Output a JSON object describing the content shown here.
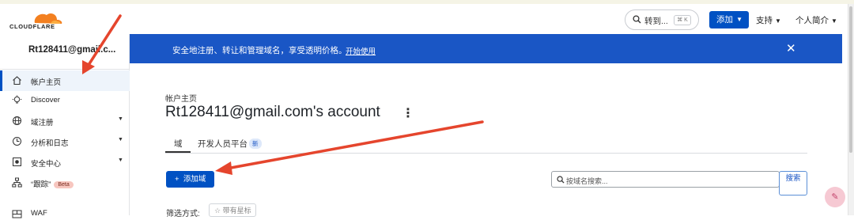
{
  "header": {
    "logo_text": "CLOUDFLARE",
    "goto_label": "转到...",
    "goto_shortcut": "⌘ K",
    "add_label": "添加",
    "support_label": "支持",
    "profile_label": "个人简介"
  },
  "sidebar": {
    "account_name": "Rt128411@gmail.c...",
    "items": [
      {
        "label": "帐户主页",
        "icon": "home-icon",
        "active": true,
        "has_chevron": false
      },
      {
        "label": "Discover",
        "icon": "lightbulb-icon",
        "active": false,
        "has_chevron": false
      },
      {
        "label": "域注册",
        "icon": "globe-icon",
        "active": false,
        "has_chevron": true
      },
      {
        "label": "分析和日志",
        "icon": "clock-chart-icon",
        "active": false,
        "has_chevron": true
      },
      {
        "label": "安全中心",
        "icon": "shield-icon",
        "active": false,
        "has_chevron": true
      },
      {
        "label": "“跟踪”",
        "icon": "network-icon",
        "active": false,
        "has_chevron": false,
        "badge": "Beta"
      },
      {
        "label": "WAF",
        "icon": "firewall-icon",
        "active": false,
        "has_chevron": false
      }
    ]
  },
  "banner": {
    "text": "安全地注册、转让和管理域名，享受透明价格。",
    "link": "开始使用"
  },
  "main": {
    "breadcrumb": "帐户主页",
    "title": "Rt128411@gmail.com's account",
    "tabs": [
      {
        "label": "域",
        "active": true
      },
      {
        "label": "开发人员平台",
        "active": false,
        "badge": "新"
      }
    ],
    "add_domain_label": "添加域",
    "search_placeholder": "按域名搜索...",
    "search_button": "搜索",
    "filter_label": "筛选方式:",
    "filter_chip": "带有星标"
  },
  "colors": {
    "accent": "#0051c3",
    "banner": "#1a56c5",
    "annotation_arrow": "#e5452d"
  }
}
